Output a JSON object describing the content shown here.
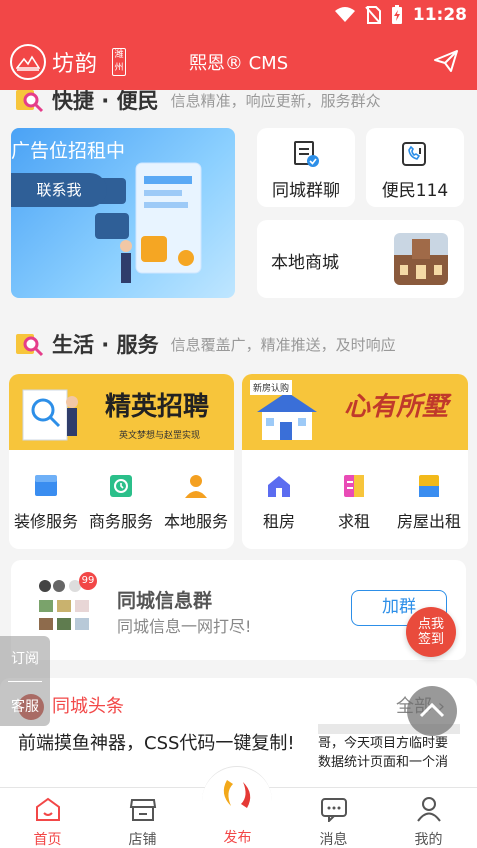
{
  "status_bar": {
    "time": "11:28"
  },
  "header": {
    "logo_text": "坊韵",
    "logo_seal": "潍州",
    "title": "熙恩® CMS"
  },
  "section_quick": {
    "title": "快捷 · 便民",
    "subtitle": "信息精准，响应更新，服务群众"
  },
  "banner": {
    "text": "广告位招租中",
    "button": "联系我"
  },
  "quick_cards": [
    {
      "label": "同城群聊",
      "icon": "group-chat-icon"
    },
    {
      "label": "便民114",
      "icon": "phone-114-icon"
    },
    {
      "label": "本地商城",
      "icon": "mall-thumbnail"
    }
  ],
  "section_life": {
    "title": "生活 · 服务",
    "subtitle": "信息覆盖广，精准推送，及时响应"
  },
  "promos": [
    {
      "text": "精英招聘",
      "small": "英文梦想与赵罡实现"
    },
    {
      "text": "心有所墅",
      "small": "新房认购"
    }
  ],
  "services_left": [
    {
      "label": "装修服务",
      "icon": "box-icon",
      "color": "#3a8df0"
    },
    {
      "label": "商务服务",
      "icon": "clock-icon",
      "color": "#2bbf8a"
    },
    {
      "label": "本地服务",
      "icon": "person-icon",
      "color": "#f4a020"
    }
  ],
  "services_right": [
    {
      "label": "租房",
      "icon": "house-icon",
      "color": "#5b6cf0"
    },
    {
      "label": "求租",
      "icon": "document-icon",
      "color": "#e94bb6"
    },
    {
      "label": "房屋出租",
      "icon": "building-icon",
      "color": "#f2b91a"
    }
  ],
  "group": {
    "title": "同城信息群",
    "subtitle": "同城信息一网打尽!",
    "badge": "99",
    "join": "加群",
    "checkin": "点我\n签到"
  },
  "side_buttons": {
    "subscribe": "订阅",
    "service": "客服"
  },
  "headlines": {
    "title": "同城头条",
    "more": "全部",
    "article_title": "前端摸鱼神器，CSS代码一键复制!",
    "snippet": "哥，今天项目方临时要数据统计页面和一个消"
  },
  "tabbar": [
    {
      "label": "首页",
      "icon": "home-icon",
      "active": true
    },
    {
      "label": "店铺",
      "icon": "store-icon",
      "active": false
    },
    {
      "label": "发布",
      "icon": "publish-icon",
      "active": false
    },
    {
      "label": "消息",
      "icon": "message-icon",
      "active": false
    },
    {
      "label": "我的",
      "icon": "profile-icon",
      "active": false
    }
  ],
  "colors": {
    "brand": "#f24747",
    "accent_yellow": "#f7c53b",
    "accent_blue": "#2d8fe8"
  }
}
